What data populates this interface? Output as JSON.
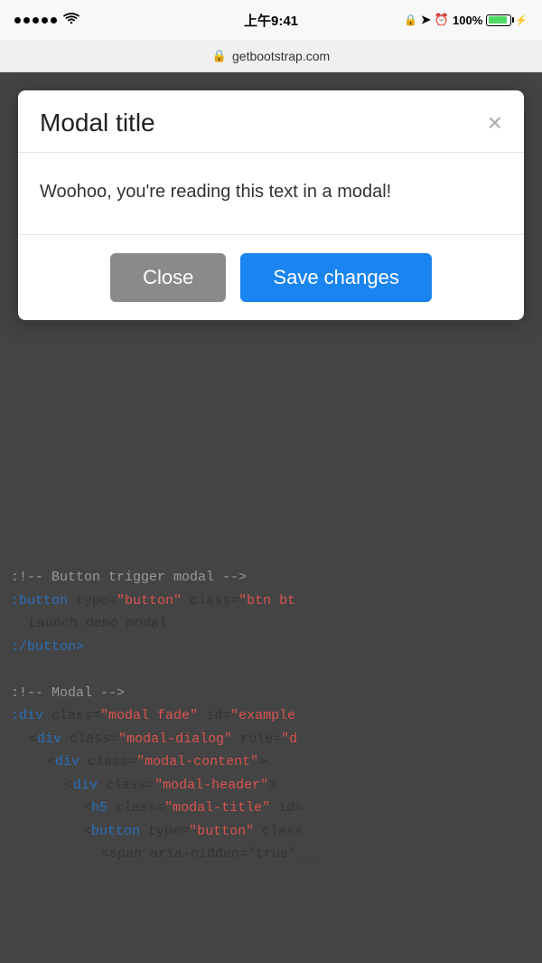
{
  "statusBar": {
    "time": "上午9:41",
    "url": "getbootstrap.com",
    "battery": "100%"
  },
  "modal": {
    "title": "Modal title",
    "close_symbol": "×",
    "body_text": "Woohoo, you're reading this text in a modal!",
    "close_label": "Close",
    "save_label": "Save changes"
  },
  "code": {
    "line1": ":!-- Button trigger modal -->",
    "line2_tag": ":button",
    "line2_rest": " type=\"button\" class=\"btn bt",
    "line3": "  Launch demo modal",
    "line4": ":/button>",
    "line5": "",
    "line6": ":!-- Modal -->",
    "line7_tag": ":div",
    "line7_rest": " class=\"modal fade\" id=\"example",
    "line8_tag": "  <div",
    "line8_rest": " class=\"modal-dialog\" role=\"d",
    "line9_tag": "    <div",
    "line9_rest": " class=\"modal-content\">",
    "line10_tag": "      <div",
    "line10_rest": " class=\"modal-header\">",
    "line11_tag": "        <h5",
    "line11_rest": " class=\"modal-title\" id=",
    "line12_tag": "        <button",
    "line12_rest": " type=\"button\" class",
    "line13": "          <span aria-hidden=\"true\"..."
  }
}
